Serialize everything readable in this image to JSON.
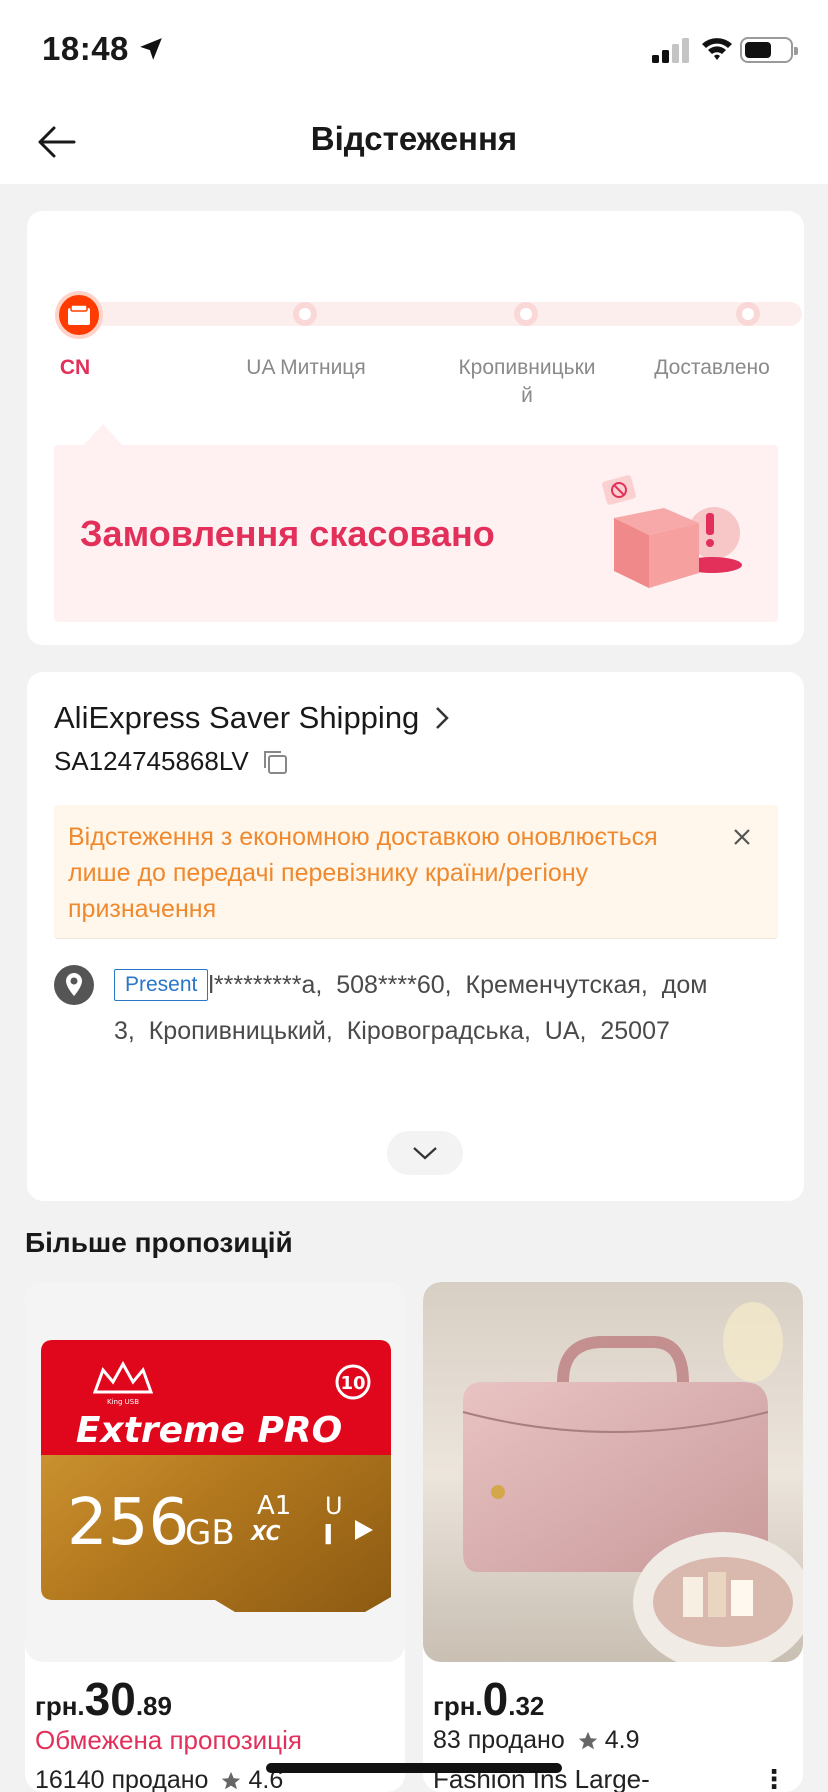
{
  "status_bar": {
    "time": "18:48"
  },
  "nav": {
    "title": "Відстеження"
  },
  "progress": {
    "steps": [
      {
        "label": "CN",
        "active": true
      },
      {
        "label": "UA Митниця",
        "active": false
      },
      {
        "label": "Кропивницьки\nй",
        "active": false
      },
      {
        "label": "Доставлено",
        "active": false
      }
    ],
    "status_text": "Замовлення скасовано"
  },
  "shipping": {
    "method": "AliExpress Saver Shipping",
    "tracking_number": "SA124745868LV",
    "notice": "Відстеження з економною доставкою оновлюється лише до передачі перевізнику країни/регіону призначення",
    "address_badge": "Present",
    "address_line1": "l*********а,  508****60,  Кременчутская,  дом",
    "address_line2": "3,  Кропивницький,  Кіровоградська,  UA,  25007"
  },
  "more": {
    "title": "Більше пропозицій",
    "products": [
      {
        "currency": "грн.",
        "price_int": "30",
        "price_dec": ".89",
        "limited": "Обмежена пропозиція",
        "sold": "16140 продано",
        "rating": "4.6",
        "card_brand": "King USB",
        "card_title": "Extreme PRO",
        "card_capacity": "256",
        "card_unit": "GB",
        "card_class": "10",
        "card_a1": "A1",
        "card_xc": "XC",
        "card_u": "U",
        "card_one": "I"
      },
      {
        "currency": "грн.",
        "price_int": "0",
        "price_dec": ".32",
        "sold": "83 продано",
        "rating": "4.9",
        "title": "Fashion Ins Large-"
      }
    ]
  },
  "colors": {
    "accent": "#e2305b",
    "notice": "#f0892d",
    "badge": "#2a76c7"
  }
}
